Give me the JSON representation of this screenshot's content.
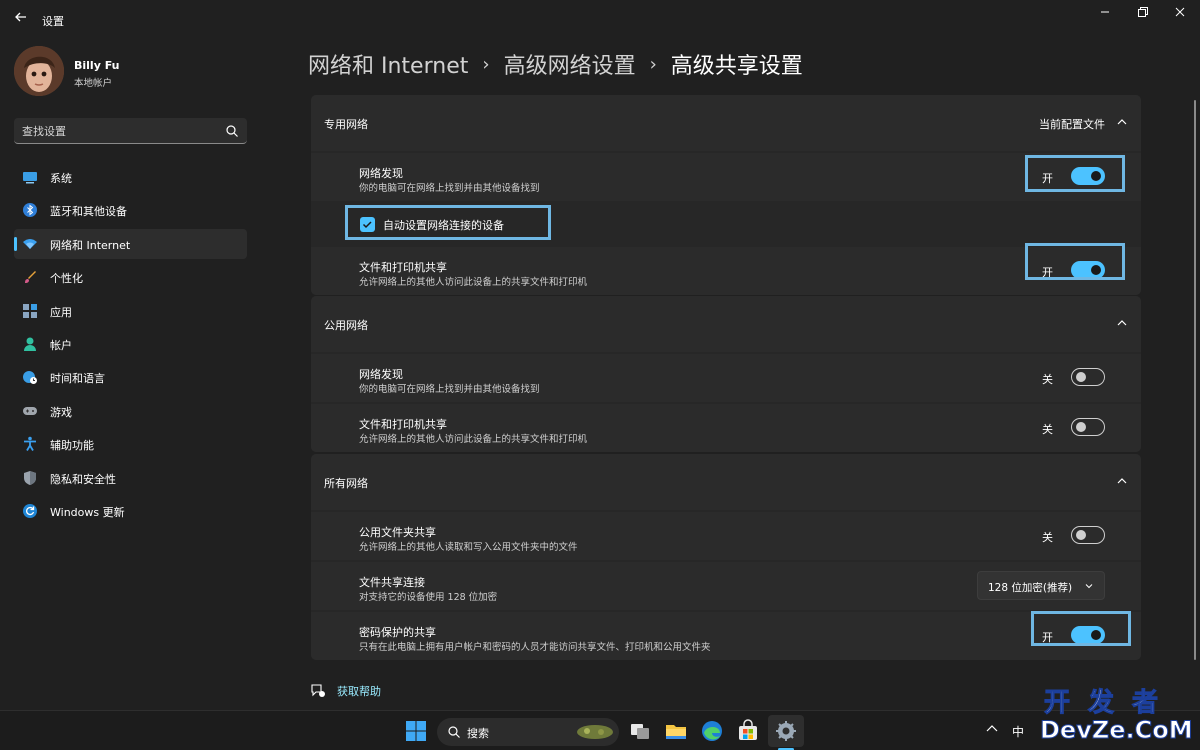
{
  "app": {
    "title": "设置",
    "back_icon": "back-arrow-icon",
    "window_controls": [
      "minimize-icon",
      "maximize-icon",
      "close-icon"
    ]
  },
  "profile": {
    "name": "Billy Fu",
    "account_type": "本地帐户"
  },
  "search": {
    "placeholder": "查找设置"
  },
  "sidebar": {
    "items": [
      {
        "label": "系统",
        "icon": "monitor-icon",
        "active": false
      },
      {
        "label": "蓝牙和其他设备",
        "icon": "bluetooth-icon",
        "active": false
      },
      {
        "label": "网络和 Internet",
        "icon": "wifi-icon",
        "active": true
      },
      {
        "label": "个性化",
        "icon": "brush-icon",
        "active": false
      },
      {
        "label": "应用",
        "icon": "apps-icon",
        "active": false
      },
      {
        "label": "帐户",
        "icon": "person-icon",
        "active": false
      },
      {
        "label": "时间和语言",
        "icon": "globe-clock-icon",
        "active": false
      },
      {
        "label": "游戏",
        "icon": "gamepad-icon",
        "active": false
      },
      {
        "label": "辅助功能",
        "icon": "accessibility-icon",
        "active": false
      },
      {
        "label": "隐私和安全性",
        "icon": "shield-icon",
        "active": false
      },
      {
        "label": "Windows 更新",
        "icon": "update-icon",
        "active": false
      }
    ]
  },
  "breadcrumb": {
    "items": [
      "网络和 Internet",
      "高级网络设置",
      "高级共享设置"
    ],
    "separator": "›"
  },
  "sections": {
    "private": {
      "title": "专用网络",
      "badge": "当前配置文件",
      "discovery": {
        "title": "网络发现",
        "desc": "你的电脑可在网络上找到并由其他设备找到",
        "state": "开"
      },
      "auto_setup": {
        "label": "自动设置网络连接的设备",
        "checked": true
      },
      "file_sharing": {
        "title": "文件和打印机共享",
        "desc": "允许网络上的其他人访问此设备上的共享文件和打印机",
        "state": "开"
      }
    },
    "public": {
      "title": "公用网络",
      "discovery": {
        "title": "网络发现",
        "desc": "你的电脑可在网络上找到并由其他设备找到",
        "state": "关"
      },
      "file_sharing": {
        "title": "文件和打印机共享",
        "desc": "允许网络上的其他人访问此设备上的共享文件和打印机",
        "state": "关"
      }
    },
    "all": {
      "title": "所有网络",
      "public_folder": {
        "title": "公用文件夹共享",
        "desc": "允许网络上的其他人读取和写入公用文件夹中的文件",
        "state": "关"
      },
      "file_conn": {
        "title": "文件共享连接",
        "desc": "对支持它的设备使用 128 位加密",
        "selected": "128 位加密(推荐)"
      },
      "password": {
        "title": "密码保护的共享",
        "desc": "只有在此电脑上拥有用户帐户和密码的人员才能访问共享文件、打印机和公用文件夹",
        "state": "开"
      }
    }
  },
  "help": {
    "label": "获取帮助"
  },
  "taskbar": {
    "search_label": "搜索",
    "ime": "中",
    "icons": [
      "start-icon",
      "search-icon",
      "task-view-icon",
      "file-explorer-icon",
      "edge-icon",
      "store-icon",
      "settings-icon"
    ]
  },
  "watermark": {
    "line1": "开发者",
    "line2": "DevZe.CoM"
  },
  "colors": {
    "accent": "#4cc2ff",
    "highlight_box": "#6fb7e3",
    "background": "#202020",
    "card": "#2b2b2b"
  }
}
